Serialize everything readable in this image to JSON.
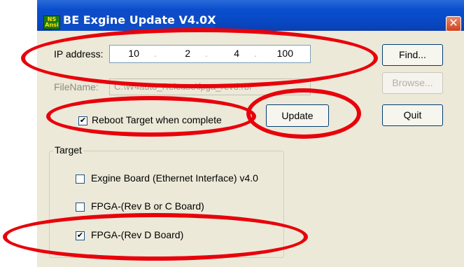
{
  "window": {
    "title": "BE Exgine Update V4.0X",
    "icon_label": "NS Ansi",
    "close_icon": "close-icon"
  },
  "form": {
    "ip_label": "IP address:",
    "ip": {
      "o1": "10",
      "o2": "2",
      "o3": "4",
      "o4": "100"
    },
    "filename_label": "FileName:",
    "filename_value": "C:\\W4auto_Release\\fpga_revd.rbf"
  },
  "buttons": {
    "find": "Find...",
    "browse": "Browse...",
    "quit": "Quit",
    "update": "Update"
  },
  "reboot": {
    "label": "Reboot Target when complete",
    "checked": true
  },
  "target": {
    "legend": "Target",
    "options": [
      {
        "label": "Exgine Board (Ethernet Interface) v4.0",
        "checked": false
      },
      {
        "label": "FPGA-(Rev B or C Board)",
        "checked": false
      },
      {
        "label": "FPGA-(Rev D Board)",
        "checked": true
      }
    ]
  },
  "annotations": {
    "color": "#e8000b"
  },
  "check_mark": "✔"
}
